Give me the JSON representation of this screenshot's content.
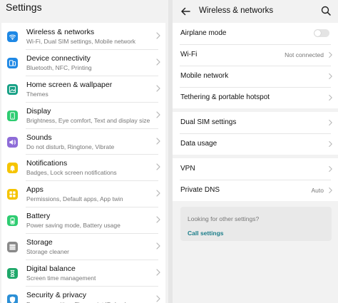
{
  "left": {
    "title": "Settings",
    "items": [
      {
        "title": "Wireless & networks",
        "subtitle": "Wi-Fi, Dual SIM settings, Mobile network",
        "icon": "wifi-icon",
        "color": "#1e88e5"
      },
      {
        "title": "Device connectivity",
        "subtitle": "Bluetooth, NFC, Printing",
        "icon": "device-connectivity-icon",
        "color": "#1e88e5"
      },
      {
        "title": "Home screen & wallpaper",
        "subtitle": "Themes",
        "icon": "wallpaper-icon",
        "color": "#16a085"
      },
      {
        "title": "Display",
        "subtitle": "Brightness, Eye comfort, Text and display size",
        "icon": "display-icon",
        "color": "#2ecc71"
      },
      {
        "title": "Sounds",
        "subtitle": "Do not disturb, Ringtone, Vibrate",
        "icon": "sound-icon",
        "color": "#8e6cd8"
      },
      {
        "title": "Notifications",
        "subtitle": "Badges, Lock screen notifications",
        "icon": "bell-icon",
        "color": "#f5c400"
      },
      {
        "title": "Apps",
        "subtitle": "Permissions, Default apps, App twin",
        "icon": "apps-grid-icon",
        "color": "#f5c400"
      },
      {
        "title": "Battery",
        "subtitle": "Power saving mode, Battery usage",
        "icon": "battery-icon",
        "color": "#2ecc71"
      },
      {
        "title": "Storage",
        "subtitle": "Storage cleaner",
        "icon": "storage-icon",
        "color": "#8a8a8a"
      },
      {
        "title": "Digital balance",
        "subtitle": "Screen time management",
        "icon": "hourglass-icon",
        "color": "#1fa86a"
      },
      {
        "title": "Security & privacy",
        "subtitle": "Face recognition, Fingerprint ID, Lock screen...",
        "icon": "shield-icon",
        "color": "#2b8fd6"
      }
    ]
  },
  "right": {
    "title": "Wireless & networks",
    "groups": [
      [
        {
          "label": "Airplane mode",
          "type": "toggle",
          "on": false
        },
        {
          "label": "Wi-Fi",
          "value": "Not connected"
        },
        {
          "label": "Mobile network"
        },
        {
          "label": "Tethering & portable hotspot"
        }
      ],
      [
        {
          "label": "Dual SIM settings"
        },
        {
          "label": "Data usage"
        }
      ],
      [
        {
          "label": "VPN"
        },
        {
          "label": "Private DNS",
          "value": "Auto"
        }
      ]
    ],
    "info": {
      "question": "Looking for other settings?",
      "link": "Call settings"
    }
  }
}
